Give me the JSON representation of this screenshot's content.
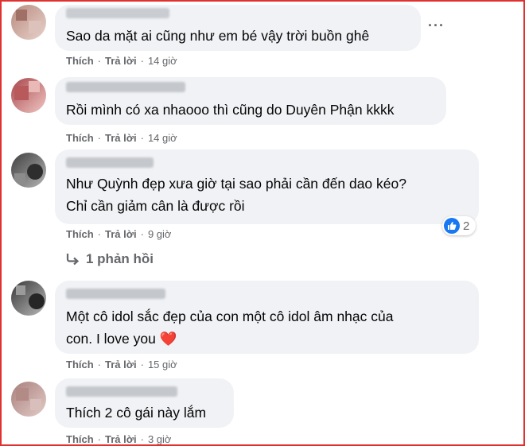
{
  "comments": [
    {
      "text_lines": [
        "Sao da mặt ai cũng như em bé vậy trời buồn ghê"
      ],
      "like_label": "Thích",
      "reply_label": "Trả lời",
      "time": "14 giờ",
      "avatar_colors": [
        "#b98a7e",
        "#d6b9ae"
      ]
    },
    {
      "text_lines": [
        "Rồi mình có xa nhaooo thì cũng do Duyên Phận kkkk"
      ],
      "like_label": "Thích",
      "reply_label": "Trả lời",
      "time": "14 giờ",
      "avatar_colors": [
        "#a8454a",
        "#e6b2b0"
      ]
    },
    {
      "text_lines": [
        "Như Quỳnh đẹp xưa giờ tại sao phải cần đến dao kéo?",
        "Chỉ cần giảm cân là được rồi"
      ],
      "like_label": "Thích",
      "reply_label": "Trả lời",
      "time": "9 giờ",
      "reaction_count": "2",
      "reaction_icon": "like-icon",
      "replies_label": "1 phản hồi",
      "avatar_colors": [
        "#4a4a4a",
        "#9b9b9b"
      ]
    },
    {
      "text_lines": [
        "Một cô idol sắc đẹp của con một cô idol âm nhạc của",
        "con. I love you ❤️"
      ],
      "like_label": "Thích",
      "reply_label": "Trả lời",
      "time": "15 giờ",
      "avatar_colors": [
        "#3d3d3d",
        "#a7a7a7"
      ]
    },
    {
      "text_lines": [
        "Thích 2 cô gái này lắm"
      ],
      "like_label": "Thích",
      "reply_label": "Trả lời",
      "time": "3 giờ",
      "avatar_colors": [
        "#a87f7c",
        "#d7b8b4"
      ]
    }
  ],
  "colors": {
    "bubble": "#f0f2f5",
    "secondary_text": "#65676b",
    "like_blue": "#1877f2",
    "frame_red": "#e03131"
  },
  "icons": {
    "more": "more-horiz-icon",
    "reply_arrow": "reply-arrow-icon",
    "heart": "heart-icon"
  }
}
